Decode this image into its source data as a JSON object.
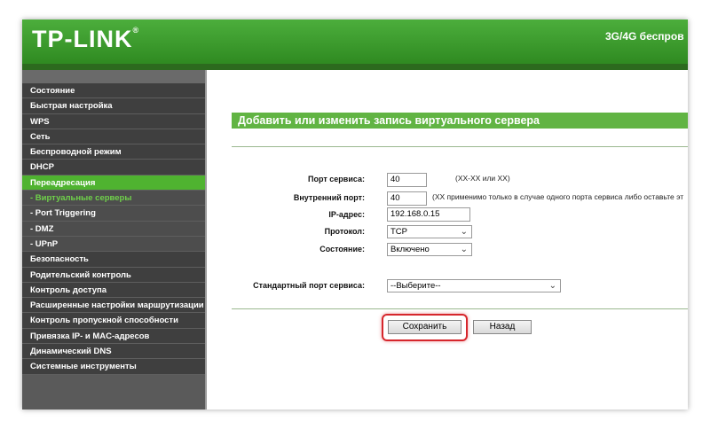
{
  "header": {
    "logo": "TP-LINK",
    "logo_mark": "®",
    "product": "3G/4G беспров"
  },
  "sidebar": {
    "items": [
      {
        "label": "Состояние",
        "state": "normal"
      },
      {
        "label": "Быстрая настройка",
        "state": "normal"
      },
      {
        "label": "WPS",
        "state": "normal"
      },
      {
        "label": "Сеть",
        "state": "normal"
      },
      {
        "label": "Беспроводной режим",
        "state": "normal"
      },
      {
        "label": "DHCP",
        "state": "normal"
      },
      {
        "label": "Переадресация",
        "state": "active"
      },
      {
        "label": "- Виртуальные серверы",
        "state": "active-sub"
      },
      {
        "label": "- Port Triggering",
        "state": "sub"
      },
      {
        "label": "- DMZ",
        "state": "sub"
      },
      {
        "label": "- UPnP",
        "state": "sub"
      },
      {
        "label": "Безопасность",
        "state": "normal"
      },
      {
        "label": "Родительский контроль",
        "state": "normal"
      },
      {
        "label": "Контроль доступа",
        "state": "normal"
      },
      {
        "label": "Расширенные настройки маршрутизации",
        "state": "normal"
      },
      {
        "label": "Контроль пропускной способности",
        "state": "normal"
      },
      {
        "label": "Привязка IP- и MAC-адресов",
        "state": "normal"
      },
      {
        "label": "Динамический DNS",
        "state": "normal"
      },
      {
        "label": "Системные инструменты",
        "state": "normal"
      }
    ]
  },
  "main": {
    "title": "Добавить или изменить запись виртуального сервера",
    "form": {
      "service_port_label": "Порт сервиса:",
      "service_port_value": "40",
      "service_port_hint": "(XX-XX или XX)",
      "internal_port_label": "Внутренний порт:",
      "internal_port_value": "40",
      "internal_port_hint": "(XX применимо только в случае одного порта сервиса либо оставьте эт",
      "ip_label": "IP-адрес:",
      "ip_value": "192.168.0.15",
      "protocol_label": "Протокол:",
      "protocol_value": "TCP",
      "status_label": "Состояние:",
      "status_value": "Включено",
      "std_port_label": "Стандартный порт сервиса:",
      "std_port_value": "--Выберите--"
    },
    "buttons": {
      "save": "Сохранить",
      "back": "Назад"
    }
  },
  "colors": {
    "brand_green": "#4cae3c",
    "active_green": "#4fb330",
    "highlight_red": "#d6262c"
  }
}
